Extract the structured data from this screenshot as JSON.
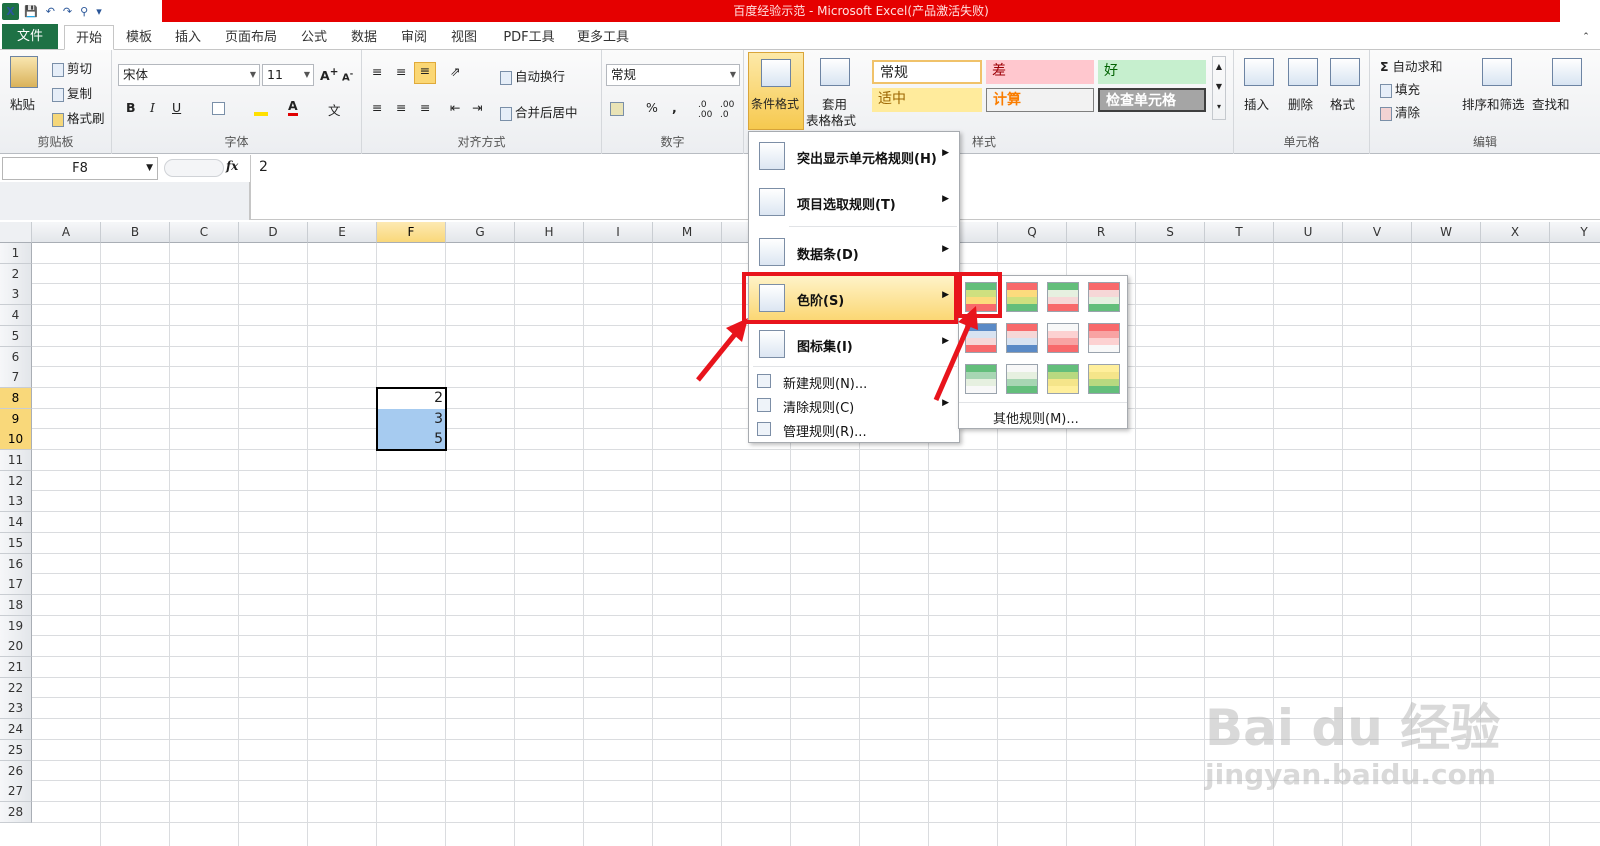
{
  "window": {
    "title": "百度经验示范 - Microsoft Excel(产品激活失败)"
  },
  "tabs": [
    "文件",
    "开始",
    "模板",
    "插入",
    "页面布局",
    "公式",
    "数据",
    "审阅",
    "视图",
    "PDF工具",
    "更多工具"
  ],
  "ribbon": {
    "clipboard": {
      "paste": "粘贴",
      "cut": "剪切",
      "copy": "复制",
      "format_painter": "格式刷",
      "group": "剪贴板"
    },
    "font": {
      "name": "宋体",
      "size": "11",
      "group": "字体",
      "bold": "B",
      "italic": "I",
      "underline": "U"
    },
    "align": {
      "wrap": "自动换行",
      "merge": "合并后居中",
      "group": "对齐方式"
    },
    "number": {
      "format": "常规",
      "percent": "%",
      "comma": ",",
      "group": "数字"
    },
    "styles": {
      "cond_format": "条件格式",
      "table_format_1": "套用",
      "table_format_2": "表格格式",
      "group": "样式",
      "normal": "常规",
      "bad": "差",
      "good": "好",
      "neutral": "适中",
      "calc": "计算",
      "check": "检查单元格"
    },
    "cells": {
      "insert": "插入",
      "delete": "删除",
      "format": "格式",
      "group": "单元格"
    },
    "editing": {
      "autosum": "自动求和",
      "fill": "填充",
      "clear": "清除",
      "sort": "排序和筛选",
      "find": "查找和",
      "group": "编辑"
    }
  },
  "formula_bar": {
    "name_box": "F8",
    "fx": "fx",
    "value": "2"
  },
  "columns": [
    "A",
    "B",
    "C",
    "D",
    "E",
    "F",
    "G",
    "H",
    "I",
    "M",
    "",
    "",
    "",
    "",
    "Q",
    "R",
    "S",
    "T",
    "U",
    "V",
    "W",
    "X",
    "Y"
  ],
  "rows": [
    "1",
    "2",
    "3",
    "4",
    "5",
    "6",
    "7",
    "8",
    "9",
    "10",
    "11",
    "12",
    "13",
    "14",
    "15",
    "16",
    "17",
    "18",
    "19",
    "20",
    "21",
    "22",
    "23",
    "24",
    "25",
    "26",
    "27",
    "28"
  ],
  "cells": [
    {
      "ref": "F8",
      "value": "2"
    },
    {
      "ref": "F9",
      "value": "3"
    },
    {
      "ref": "F10",
      "value": "5"
    }
  ],
  "cf_menu": {
    "items": [
      "突出显示单元格规则(H)",
      "项目选取规则(T)",
      "数据条(D)",
      "色阶(S)",
      "图标集(I)"
    ],
    "small_items": [
      "新建规则(N)...",
      "清除规则(C)",
      "管理规则(R)..."
    ]
  },
  "color_scale_menu": {
    "other_rules": "其他规则(M)..."
  },
  "watermark": {
    "brand": "Bai du 经验",
    "url": "jingyan.baidu.com"
  },
  "colors": {
    "title_red": "#e50000",
    "highlight_red": "#e8141c",
    "file_tab": "#1e7145",
    "selection_blue": "#a6cbf0"
  }
}
